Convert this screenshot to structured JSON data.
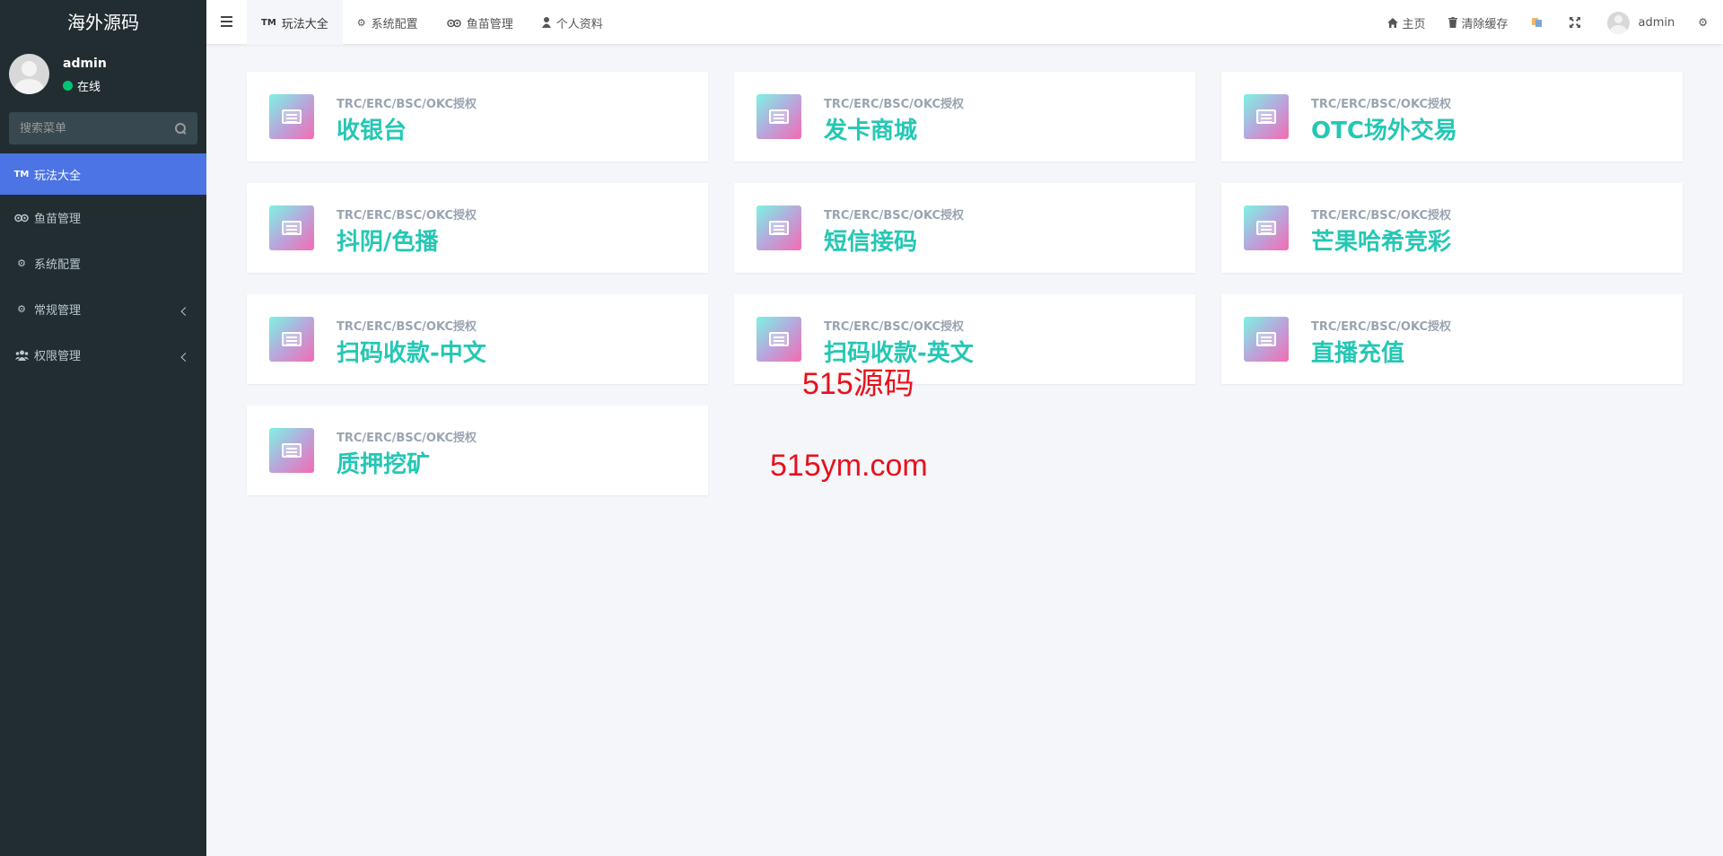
{
  "sidebar": {
    "brand": "海外源码",
    "user": {
      "name": "admin",
      "status": "在线"
    },
    "search": {
      "placeholder": "搜索菜单"
    },
    "items": [
      {
        "label": "玩法大全",
        "icon": "tm-icon",
        "active": true
      },
      {
        "label": "鱼苗管理",
        "icon": "tripadvisor-icon"
      },
      {
        "label": "系统配置",
        "icon": "gear-icon"
      },
      {
        "label": "常规管理",
        "icon": "gears-icon",
        "expandable": true
      },
      {
        "label": "权限管理",
        "icon": "users-icon",
        "expandable": true
      }
    ]
  },
  "topbar": {
    "tabs": [
      {
        "label": "玩法大全",
        "icon": "tm-icon",
        "active": true
      },
      {
        "label": "系统配置",
        "icon": "gear-icon"
      },
      {
        "label": "鱼苗管理",
        "icon": "tripadvisor-icon"
      },
      {
        "label": "个人资料",
        "icon": "user-icon"
      }
    ],
    "right": {
      "home": "主页",
      "clear_cache": "清除缓存",
      "user": "admin"
    }
  },
  "cards": [
    {
      "subtitle": "TRC/ERC/BSC/OKC授权",
      "title": "收银台"
    },
    {
      "subtitle": "TRC/ERC/BSC/OKC授权",
      "title": "发卡商城"
    },
    {
      "subtitle": "TRC/ERC/BSC/OKC授权",
      "title": "OTC场外交易"
    },
    {
      "subtitle": "TRC/ERC/BSC/OKC授权",
      "title": "抖阴/色播"
    },
    {
      "subtitle": "TRC/ERC/BSC/OKC授权",
      "title": "短信接码"
    },
    {
      "subtitle": "TRC/ERC/BSC/OKC授权",
      "title": "芒果哈希竞彩"
    },
    {
      "subtitle": "TRC/ERC/BSC/OKC授权",
      "title": "扫码收款-中文"
    },
    {
      "subtitle": "TRC/ERC/BSC/OKC授权",
      "title": "扫码收款-英文"
    },
    {
      "subtitle": "TRC/ERC/BSC/OKC授权",
      "title": "直播充值"
    },
    {
      "subtitle": "TRC/ERC/BSC/OKC授权",
      "title": "质押挖矿"
    }
  ],
  "watermark": {
    "line1": "515源码",
    "line2": "515ym.com"
  },
  "colors": {
    "sidebar_bg": "#222d32",
    "active_menu": "#4c74e4",
    "card_title": "#25c7b4",
    "watermark": "#e8111c"
  }
}
